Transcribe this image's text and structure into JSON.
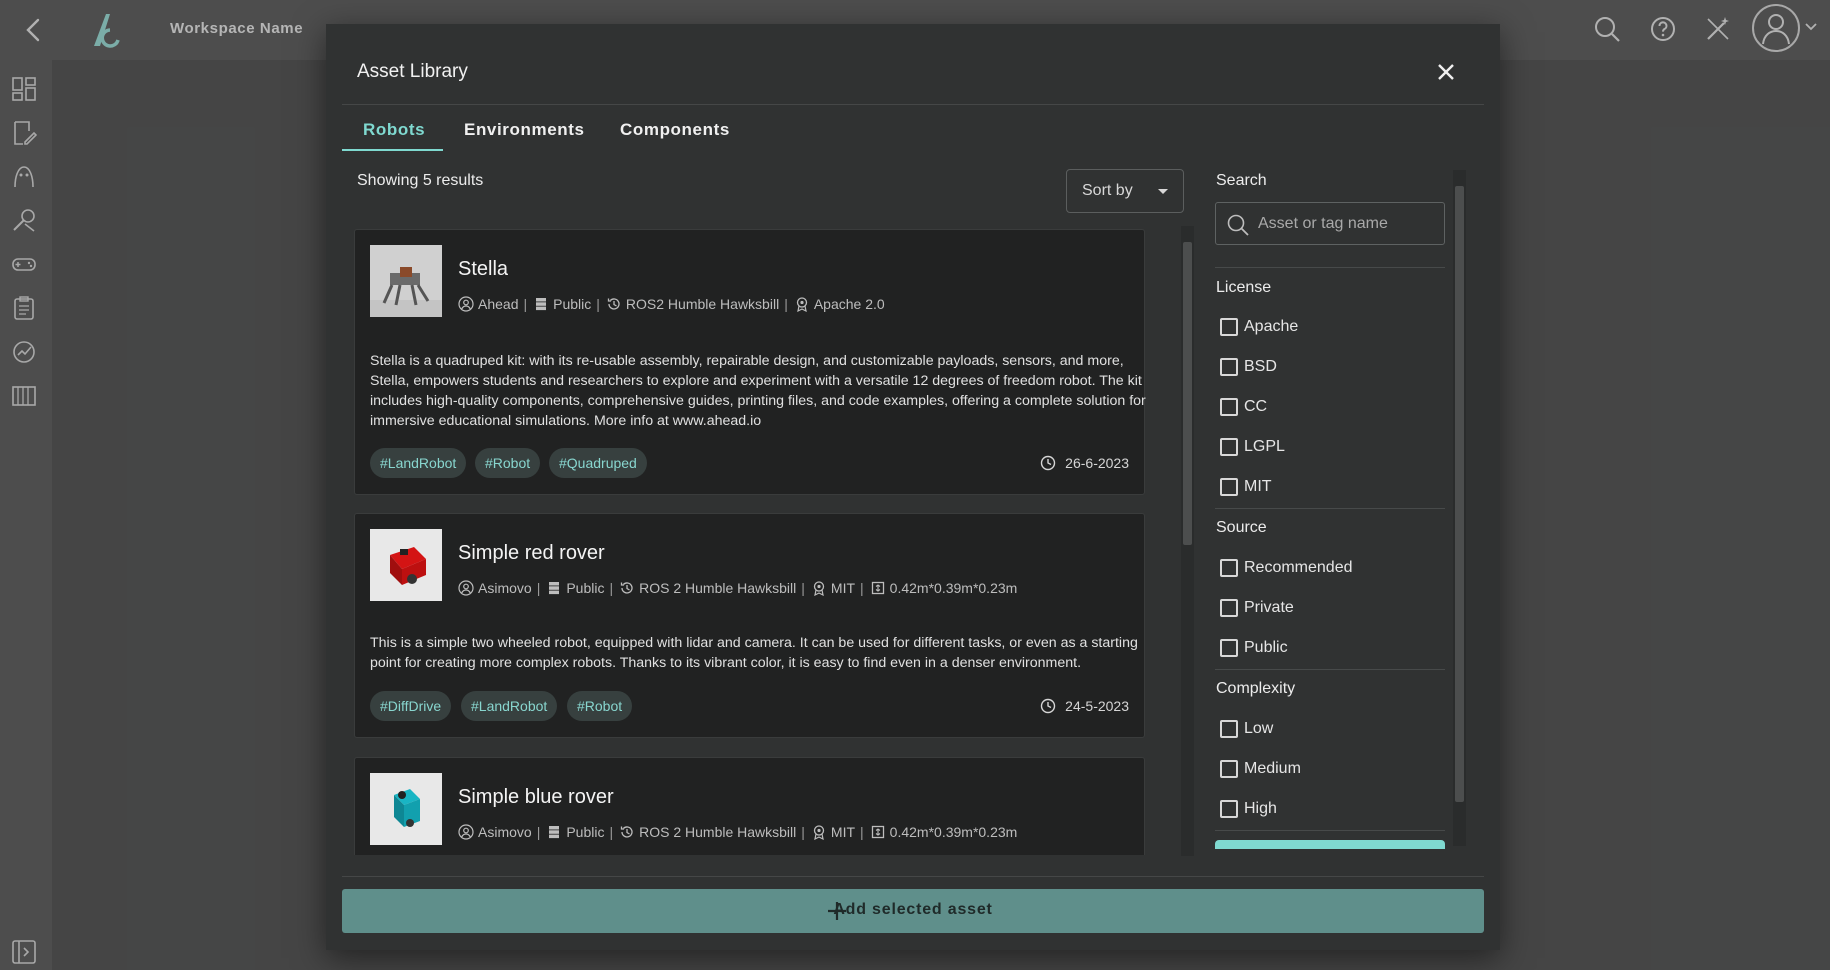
{
  "app": {
    "workspace_name": "Workspace Name",
    "icons": [
      "back-arrow-icon",
      "logo-icon",
      "search-icon",
      "help-icon",
      "magic-wand-icon",
      "account-icon",
      "chevron-down-icon"
    ],
    "sidebar_icons": [
      "dashboard-icon",
      "edit-document-icon",
      "robot-head-icon",
      "tools-icon",
      "gamepad-icon",
      "clipboard-icon",
      "analytics-icon",
      "piano-icon",
      "collapse-sidebar-icon"
    ]
  },
  "modal": {
    "title": "Asset Library",
    "tabs": [
      {
        "label": "Robots",
        "active": true
      },
      {
        "label": "Environments",
        "active": false
      },
      {
        "label": "Components",
        "active": false
      }
    ],
    "results_text": "Showing 5 results",
    "sort_label": "Sort by",
    "assets": [
      {
        "name": "Stella",
        "author": "Ahead",
        "visibility": "Public",
        "ros": "ROS2 Humble Hawksbill",
        "license": "Apache 2.0",
        "size": "",
        "description": "Stella is a quadruped kit: with its re-usable assembly, repairable design, and customizable payloads, sensors, and more, Stella, empowers students and researchers to explore and experiment with a versatile 12 degrees of freedom robot. The kit includes high-quality components, comprehensive guides, printing files, and code examples, offering a complete solution for immersive educational simulations. More info at www.ahead.io",
        "tags": [
          "#LandRobot",
          "#Robot",
          "#Quadruped"
        ],
        "date": "26-6-2023"
      },
      {
        "name": "Simple red rover",
        "author": "Asimovo",
        "visibility": "Public",
        "ros": "ROS 2 Humble Hawksbill",
        "license": "MIT",
        "size": "0.42m*0.39m*0.23m",
        "description": "This is a simple two wheeled robot, equipped with lidar and camera. It can be used for different tasks, or even as a starting point for creating more complex robots. Thanks to its vibrant color, it is easy to find even in a denser environment.",
        "tags": [
          "#DiffDrive",
          "#LandRobot",
          "#Robot"
        ],
        "date": "24-5-2023"
      },
      {
        "name": "Simple blue rover",
        "author": "Asimovo",
        "visibility": "Public",
        "ros": "ROS 2 Humble Hawksbill",
        "license": "MIT",
        "size": "0.42m*0.39m*0.23m"
      }
    ],
    "filters": {
      "search_label": "Search",
      "search_placeholder": "Asset or tag name",
      "license_label": "License",
      "license_options": [
        "Apache",
        "BSD",
        "CC",
        "LGPL",
        "MIT"
      ],
      "source_label": "Source",
      "source_options": [
        "Recommended",
        "Private",
        "Public"
      ],
      "complexity_label": "Complexity",
      "complexity_options": [
        "Low",
        "Medium",
        "High"
      ]
    },
    "add_button_label": "Add selected asset",
    "colors": {
      "accent": "#7fd9d0",
      "tag_bg": "#37403f",
      "button": "#5f8f8b"
    }
  }
}
